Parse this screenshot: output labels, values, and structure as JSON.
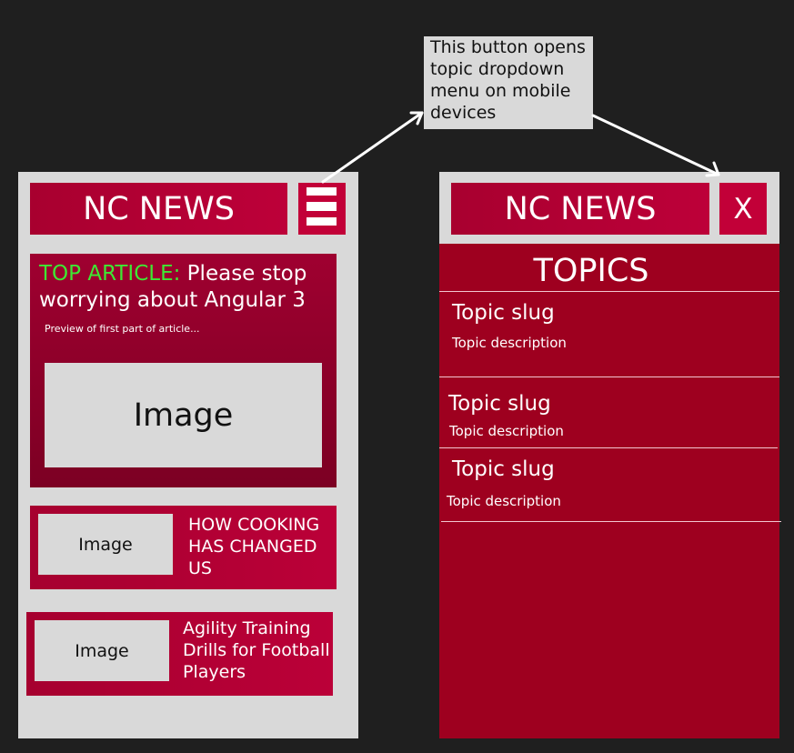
{
  "annotation": {
    "lines": [
      "This button opens",
      "topic dropdown",
      "menu on mobile",
      "devices"
    ]
  },
  "left_screen": {
    "logo": "NC NEWS",
    "menu_icon": "hamburger-menu-icon",
    "top_article": {
      "label": "TOP ARTICLE:",
      "title": " Please stop worrying about Angular 3",
      "preview": "Preview of first part of article...",
      "image_label": "Image"
    },
    "articles": [
      {
        "image_label": "Image",
        "title": "HOW COOKING HAS CHANGED US"
      },
      {
        "image_label": "Image",
        "title": "Agility Training Drills for Football Players"
      }
    ]
  },
  "right_screen": {
    "logo": "NC NEWS",
    "close_label": "X",
    "topics_heading": "TOPICS",
    "topics": [
      {
        "slug": "Topic slug",
        "description": "Topic description"
      },
      {
        "slug": "Topic slug",
        "description": "Topic description"
      },
      {
        "slug": "Topic slug",
        "description": "Topic description"
      }
    ]
  },
  "colors": {
    "background": "#1f1f1f",
    "phone": "#d9d9d9",
    "brand": "#bd0039",
    "panel": "#9e001f",
    "highlight": "#3ee833"
  }
}
